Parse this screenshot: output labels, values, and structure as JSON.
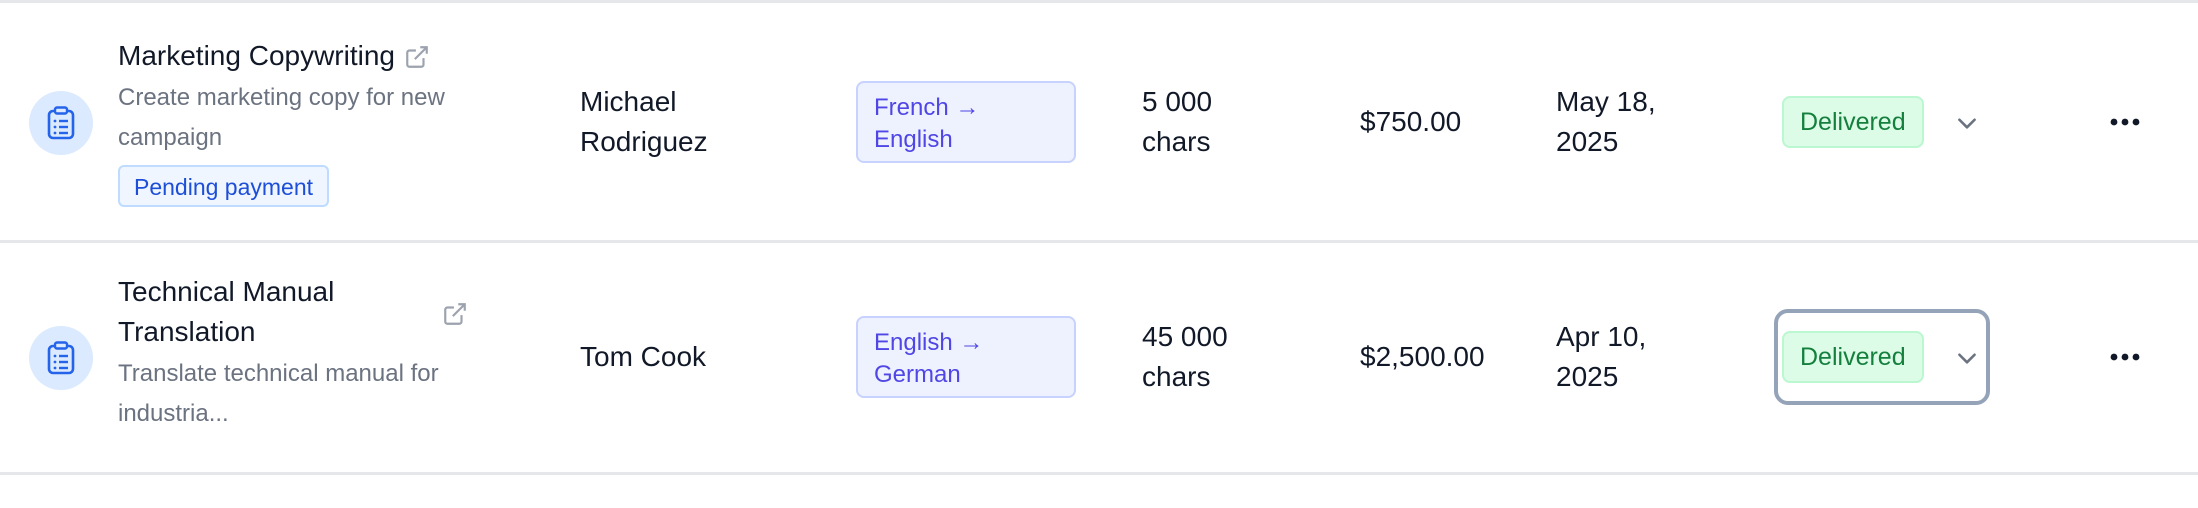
{
  "rows": [
    {
      "title": "Marketing Copywriting",
      "description": [
        "Create marketing copy for new",
        "campaign"
      ],
      "tag": "Pending payment",
      "client": [
        "Michael",
        "Rodriguez"
      ],
      "lang_from": "French →",
      "lang_to": "English",
      "volume": [
        "5 000",
        "chars"
      ],
      "price": "$750.00",
      "date": [
        "May 18,",
        "2025"
      ],
      "status": "Delivered"
    },
    {
      "title": [
        "Technical Manual",
        "Translation"
      ],
      "description": [
        "Translate technical manual for",
        "industria..."
      ],
      "client": [
        "Tom Cook"
      ],
      "lang_from": "English →",
      "lang_to": "German",
      "volume": [
        "45 000",
        "chars"
      ],
      "price": "$2,500.00",
      "date": [
        "Apr 10,",
        "2025"
      ],
      "status": "Delivered"
    }
  ],
  "colors": {
    "icon_bg": "#dbeafe",
    "icon_fg": "#2563eb",
    "lang_accent": "#4f46e5",
    "status_green": "#15803d",
    "pending_blue": "#1d4ed8"
  },
  "icons": [
    "clipboard-icon",
    "external-link-icon",
    "chevron-down-icon",
    "more-horizontal-icon"
  ]
}
